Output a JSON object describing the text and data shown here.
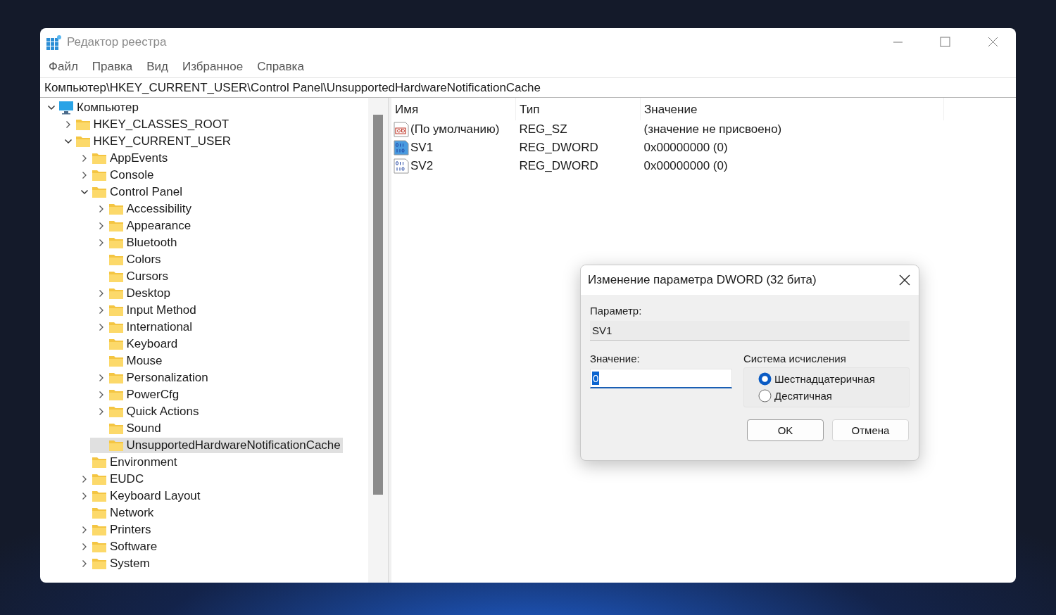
{
  "window": {
    "title": "Редактор реестра"
  },
  "menu": [
    "Файл",
    "Правка",
    "Вид",
    "Избранное",
    "Справка"
  ],
  "address": "Компьютер\\HKEY_CURRENT_USER\\Control Panel\\UnsupportedHardwareNotificationCache",
  "tree": [
    {
      "label": "Компьютер",
      "kind": "computer",
      "expandable": true,
      "expanded": true,
      "selected": false,
      "children": [
        {
          "label": "HKEY_CLASSES_ROOT",
          "kind": "folder",
          "expandable": true,
          "expanded": false,
          "selected": false
        },
        {
          "label": "HKEY_CURRENT_USER",
          "kind": "folder",
          "expandable": true,
          "expanded": true,
          "selected": false,
          "children": [
            {
              "label": "AppEvents",
              "kind": "folder",
              "expandable": true,
              "expanded": false,
              "selected": false
            },
            {
              "label": "Console",
              "kind": "folder",
              "expandable": true,
              "expanded": false,
              "selected": false
            },
            {
              "label": "Control Panel",
              "kind": "folder",
              "expandable": true,
              "expanded": true,
              "selected": false,
              "children": [
                {
                  "label": "Accessibility",
                  "kind": "folder",
                  "expandable": true,
                  "expanded": false,
                  "selected": false
                },
                {
                  "label": "Appearance",
                  "kind": "folder",
                  "expandable": true,
                  "expanded": false,
                  "selected": false
                },
                {
                  "label": "Bluetooth",
                  "kind": "folder",
                  "expandable": true,
                  "expanded": false,
                  "selected": false
                },
                {
                  "label": "Colors",
                  "kind": "folder",
                  "expandable": false,
                  "selected": false
                },
                {
                  "label": "Cursors",
                  "kind": "folder",
                  "expandable": false,
                  "selected": false
                },
                {
                  "label": "Desktop",
                  "kind": "folder",
                  "expandable": true,
                  "expanded": false,
                  "selected": false
                },
                {
                  "label": "Input Method",
                  "kind": "folder",
                  "expandable": true,
                  "expanded": false,
                  "selected": false
                },
                {
                  "label": "International",
                  "kind": "folder",
                  "expandable": true,
                  "expanded": false,
                  "selected": false
                },
                {
                  "label": "Keyboard",
                  "kind": "folder",
                  "expandable": false,
                  "selected": false
                },
                {
                  "label": "Mouse",
                  "kind": "folder",
                  "expandable": false,
                  "selected": false
                },
                {
                  "label": "Personalization",
                  "kind": "folder",
                  "expandable": true,
                  "expanded": false,
                  "selected": false
                },
                {
                  "label": "PowerCfg",
                  "kind": "folder",
                  "expandable": true,
                  "expanded": false,
                  "selected": false
                },
                {
                  "label": "Quick Actions",
                  "kind": "folder",
                  "expandable": true,
                  "expanded": false,
                  "selected": false
                },
                {
                  "label": "Sound",
                  "kind": "folder",
                  "expandable": false,
                  "selected": false
                },
                {
                  "label": "UnsupportedHardwareNotificationCache",
                  "kind": "folder",
                  "expandable": false,
                  "selected": true
                }
              ]
            },
            {
              "label": "Environment",
              "kind": "folder",
              "expandable": false,
              "selected": false
            },
            {
              "label": "EUDC",
              "kind": "folder",
              "expandable": true,
              "expanded": false,
              "selected": false
            },
            {
              "label": "Keyboard Layout",
              "kind": "folder",
              "expandable": true,
              "expanded": false,
              "selected": false
            },
            {
              "label": "Network",
              "kind": "folder",
              "expandable": false,
              "selected": false
            },
            {
              "label": "Printers",
              "kind": "folder",
              "expandable": true,
              "expanded": false,
              "selected": false
            },
            {
              "label": "Software",
              "kind": "folder",
              "expandable": true,
              "expanded": false,
              "selected": false
            },
            {
              "label": "System",
              "kind": "folder",
              "expandable": true,
              "expanded": false,
              "selected": false
            }
          ]
        }
      ]
    }
  ],
  "values": {
    "columns": [
      "Имя",
      "Тип",
      "Значение"
    ],
    "rows": [
      {
        "kind": "string",
        "name": "(По умолчанию)",
        "type": "REG_SZ",
        "data": "(значение не присвоено)",
        "selected": false
      },
      {
        "kind": "dword",
        "name": "SV1",
        "type": "REG_DWORD",
        "data": "0x00000000 (0)",
        "selected": true
      },
      {
        "kind": "dword",
        "name": "SV2",
        "type": "REG_DWORD",
        "data": "0x00000000 (0)",
        "selected": false
      }
    ]
  },
  "dialog": {
    "title": "Изменение параметра DWORD (32 бита)",
    "param_label": "Параметр:",
    "param_value": "SV1",
    "value_label": "Значение:",
    "value": "0",
    "base_group": "Система исчисления",
    "bases": [
      {
        "label": "Шестнадцатеричная",
        "selected": true
      },
      {
        "label": "Десятичная",
        "selected": false
      }
    ],
    "buttons": [
      {
        "label": "OK",
        "default": true
      },
      {
        "label": "Отмена",
        "default": false
      }
    ]
  }
}
